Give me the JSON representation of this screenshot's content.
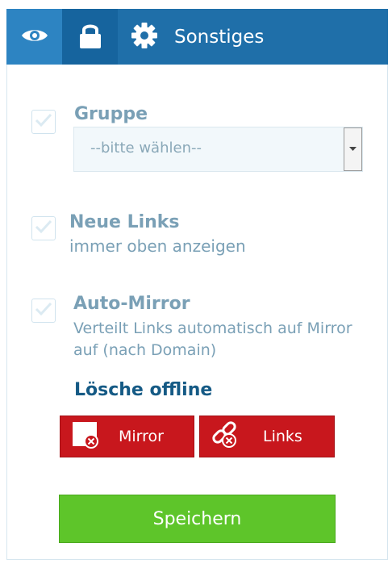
{
  "tabs": {
    "misc_label": "Sonstiges"
  },
  "group": {
    "label": "Gruppe",
    "select_value": "--bitte wählen--"
  },
  "new_links": {
    "label": "Neue Links",
    "description": "immer oben anzeigen"
  },
  "auto_mirror": {
    "label": "Auto-Mirror",
    "description_line1": "Verteilt Links automatisch auf Mirror",
    "description_line2": "auf (nach Domain)"
  },
  "delete_offline": {
    "heading": "Lösche offline",
    "mirror_label": "Mirror",
    "links_label": "Links"
  },
  "save_label": "Speichern",
  "colors": {
    "tab_active": "#2d84c2",
    "tab_bar": "#1f6fa9",
    "label": "#7aa0b6",
    "heading": "#155a85",
    "danger": "#c8171d",
    "success": "#5ec52a"
  }
}
